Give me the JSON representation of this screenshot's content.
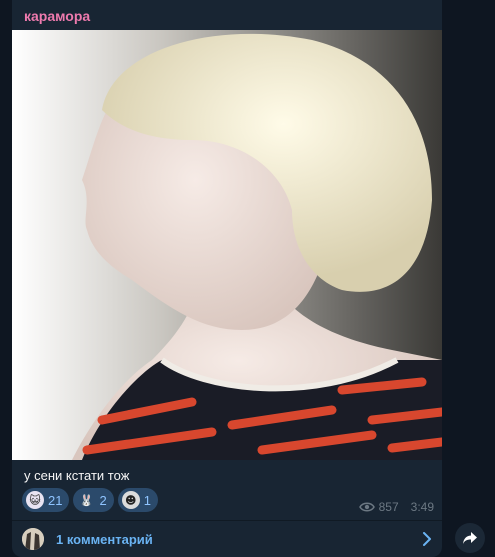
{
  "post": {
    "author": "карамора",
    "caption": "у сени кстати тож",
    "reactions": [
      {
        "icon": "cat-sticker-emoji",
        "count": "21"
      },
      {
        "icon": "bunny-emoji",
        "count": "2"
      },
      {
        "icon": "troll-face-emoji",
        "count": "1"
      }
    ],
    "views": "857",
    "time": "3:49",
    "comments_label": "1 комментарий"
  },
  "colors": {
    "author": "#ee7aae",
    "link": "#6ab3f3",
    "reaction_bg": "#2b4a6b",
    "bubble_bg": "#182533",
    "page_bg": "#0e1621"
  }
}
